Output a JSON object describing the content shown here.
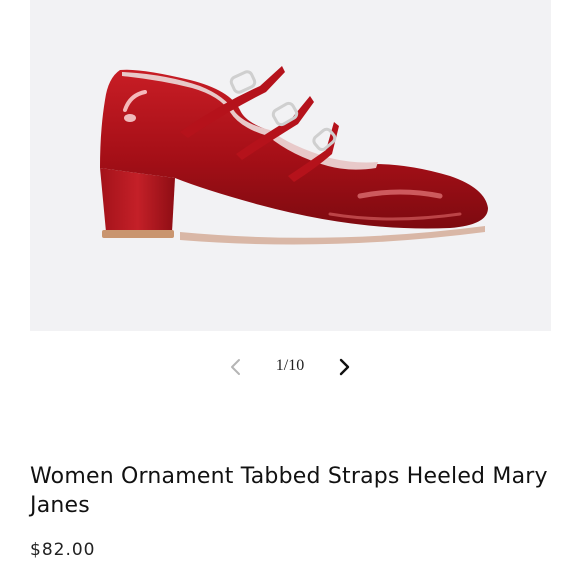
{
  "product": {
    "image_alt": "Red patent Mary Jane shoe with three buckled straps",
    "title": "Women Ornament Tabbed Straps Heeled Mary Janes",
    "price": "$82.00",
    "colors": {
      "shoe": "#b3121a",
      "background": "#f2f2f4"
    }
  },
  "gallery": {
    "counter": "1/10",
    "prev_icon": "chevron-left-icon",
    "next_icon": "chevron-right-icon"
  }
}
